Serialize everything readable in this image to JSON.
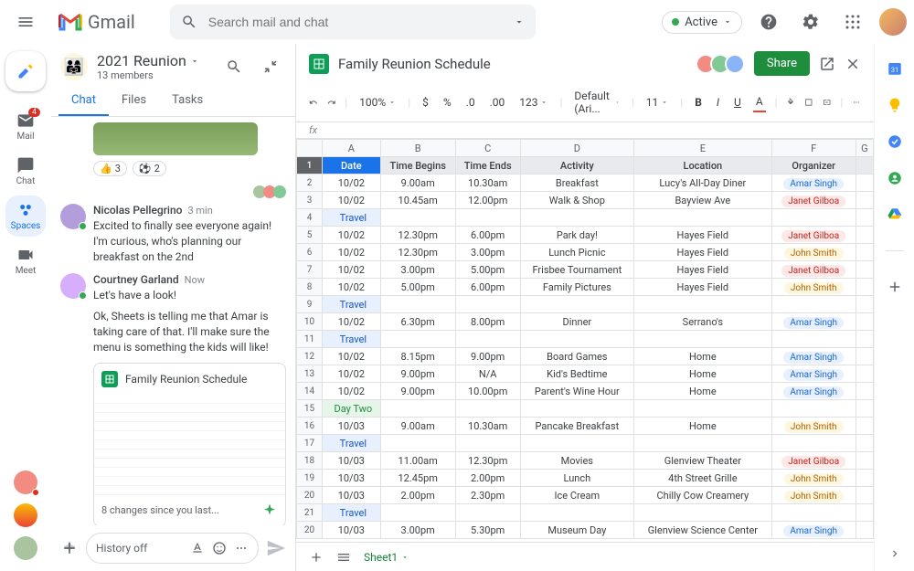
{
  "app": {
    "name": "Gmail",
    "search_placeholder": "Search mail and chat",
    "active_label": "Active"
  },
  "nav": {
    "mail": "Mail",
    "mail_badge": "4",
    "chat": "Chat",
    "spaces": "Spaces",
    "meet": "Meet"
  },
  "space": {
    "title": "2021 Reunion",
    "members": "13 members",
    "tabs": {
      "chat": "Chat",
      "files": "Files",
      "tasks": "Tasks"
    },
    "reactions": [
      {
        "emoji": "👍",
        "count": "3"
      },
      {
        "emoji": "⚽",
        "count": "2"
      }
    ],
    "msg1": {
      "name": "Nicolas Pellegrino",
      "time": "3 min",
      "text": "Excited to finally see everyone again! I'm curious, who's planning our breakfast on the 2nd"
    },
    "msg2": {
      "name": "Courtney Garland",
      "time": "Now",
      "text1": "Let's have a look!",
      "text2": "Ok, Sheets is telling me that Amar is taking care of that. I'll make sure the menu is something the kids will like!"
    },
    "card": {
      "title": "Family Reunion Schedule",
      "footer": "8 changes since you last..."
    },
    "input": "History off"
  },
  "sheet": {
    "title": "Family Reunion Schedule",
    "share": "Share",
    "zoom": "100%",
    "font": "Default (Ari...",
    "size": "11",
    "tab": "Sheet1",
    "cols": [
      "A",
      "B",
      "C",
      "D",
      "E",
      "F",
      "G"
    ],
    "headers": [
      "Date",
      "Time Begins",
      "Time Ends",
      "Activity",
      "Location",
      "Organizer"
    ]
  },
  "chart_data": {
    "type": "table",
    "title": "Family Reunion Schedule",
    "columns": [
      "row",
      "Date",
      "Time Begins",
      "Time Ends",
      "Activity",
      "Location",
      "Organizer"
    ],
    "rows": [
      [
        "2",
        "10/02",
        "9.00am",
        "10.30am",
        "Breakfast",
        "Lucy's All-Day Diner",
        "Amar Singh"
      ],
      [
        "3",
        "10/02",
        "10.45am",
        "12.00pm",
        "Walk & Shop",
        "Bayview Ave",
        "Janet Gilboa"
      ],
      [
        "4",
        "Travel",
        "",
        "",
        "",
        "",
        ""
      ],
      [
        "5",
        "10/02",
        "12.30pm",
        "6.00pm",
        "Park day!",
        "Hayes Field",
        "Janet Gilboa"
      ],
      [
        "6",
        "10/02",
        "12.30pm",
        "3.00pm",
        "Lunch Picnic",
        "Hayes Field",
        "John Smith"
      ],
      [
        "7",
        "10/02",
        "3.00pm",
        "5.00pm",
        "Frisbee Tournament",
        "Hayes Field",
        "Janet Gilboa"
      ],
      [
        "8",
        "10/02",
        "5.00pm",
        "6.00pm",
        "Family Pictures",
        "Hayes Field",
        "John Smith"
      ],
      [
        "9",
        "Travel",
        "",
        "",
        "",
        "",
        ""
      ],
      [
        "10",
        "10/02",
        "6.30pm",
        "8.00pm",
        "Dinner",
        "Serrano's",
        "Amar Singh"
      ],
      [
        "11",
        "Travel",
        "",
        "",
        "",
        "",
        ""
      ],
      [
        "12",
        "10/02",
        "8.15pm",
        "9.00pm",
        "Board Games",
        "Home",
        "Amar Singh"
      ],
      [
        "13",
        "10/02",
        "9.00pm",
        "N/A",
        "Kid's Bedtime",
        "Home",
        "Amar Singh"
      ],
      [
        "14",
        "10/02",
        "9.00pm",
        "10.00pm",
        "Parent's Wine Hour",
        "Home",
        "Amar Singh"
      ],
      [
        "15",
        "Day Two",
        "",
        "",
        "",
        "",
        ""
      ],
      [
        "16",
        "10/03",
        "9.00am",
        "10.30am",
        "Pancake Breakfast",
        "Home",
        "John Smith"
      ],
      [
        "17",
        "Travel",
        "",
        "",
        "",
        "",
        ""
      ],
      [
        "18",
        "10/03",
        "11.00am",
        "12.30pm",
        "Movies",
        "Glenview Theater",
        "Janet Gilboa"
      ],
      [
        "19",
        "10/03",
        "12.45pm",
        "2.00pm",
        "Lunch",
        "4th Street Grille",
        "John Smith"
      ],
      [
        "20",
        "10/03",
        "2.00pm",
        "2.30pm",
        "Ice Cream",
        "Chilly Cow Creamery",
        "John Smith"
      ],
      [
        "21",
        "Travel",
        "",
        "",
        "",
        "",
        ""
      ],
      [
        "20",
        "10/03",
        "3.00pm",
        "5.30pm",
        "Museum Day",
        "Glenview Science Center",
        "Amar Singh"
      ]
    ]
  },
  "organizers": {
    "Amar Singh": "chip-s",
    "Janet Gilboa": "chip-g",
    "John Smith": "chip-j"
  }
}
